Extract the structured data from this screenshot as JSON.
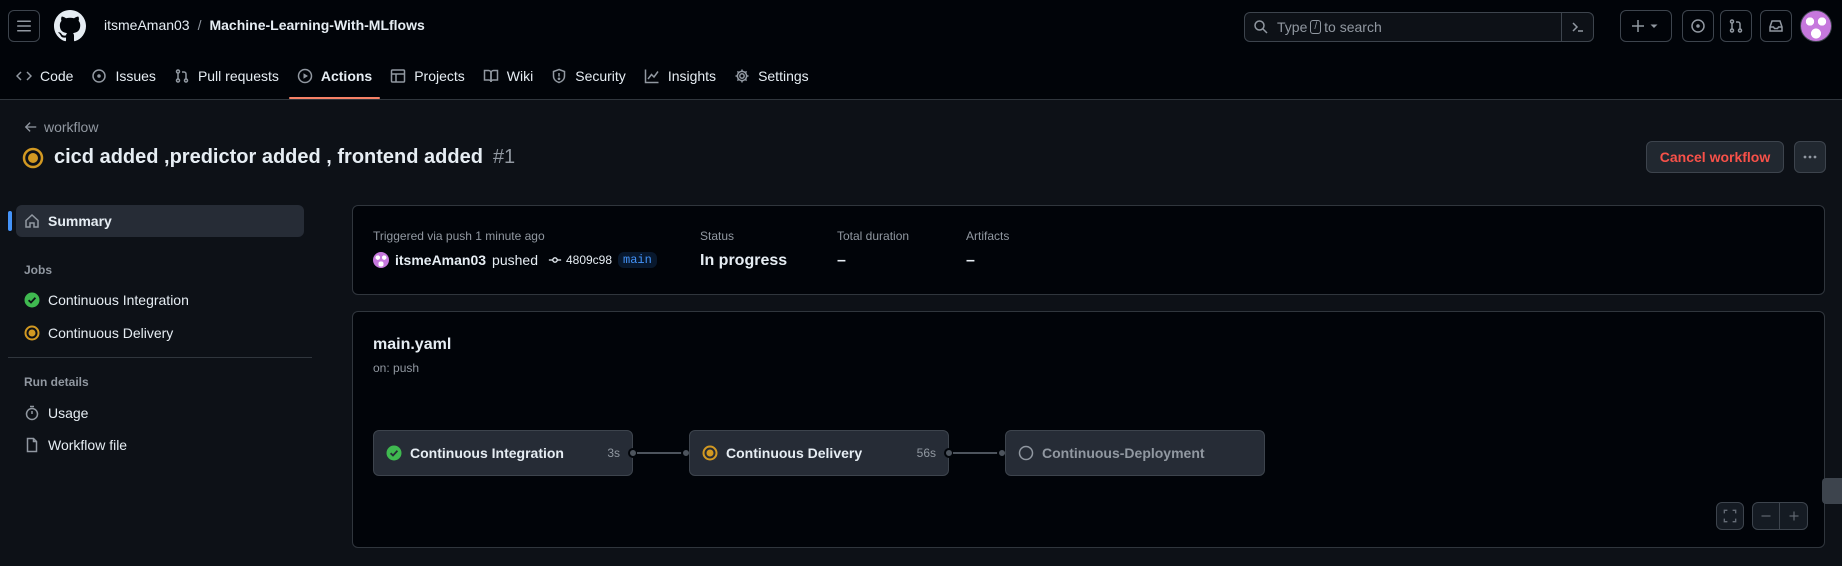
{
  "header": {
    "owner": "itsmeAman03",
    "separator": "/",
    "repo": "Machine-Learning-With-MLflows",
    "search": {
      "prefix": "Type",
      "key": "/",
      "suffix": "to search"
    }
  },
  "repo_nav": {
    "tabs": [
      {
        "label": "Code",
        "icon": "code-icon"
      },
      {
        "label": "Issues",
        "icon": "issue-icon"
      },
      {
        "label": "Pull requests",
        "icon": "pull-request-icon"
      },
      {
        "label": "Actions",
        "icon": "play-icon",
        "active": true
      },
      {
        "label": "Projects",
        "icon": "table-icon"
      },
      {
        "label": "Wiki",
        "icon": "book-icon"
      },
      {
        "label": "Security",
        "icon": "shield-icon"
      },
      {
        "label": "Insights",
        "icon": "graph-icon"
      },
      {
        "label": "Settings",
        "icon": "gear-icon"
      }
    ]
  },
  "run": {
    "back_label": "workflow",
    "title": "cicd added ,predictor added , frontend added",
    "number": "#1",
    "status_color": "#d29922",
    "cancel_label": "Cancel workflow"
  },
  "sidebar": {
    "summary_label": "Summary",
    "jobs_heading": "Jobs",
    "jobs": [
      {
        "label": "Continuous Integration",
        "status": "success"
      },
      {
        "label": "Continuous Delivery",
        "status": "in_progress"
      }
    ],
    "run_details_heading": "Run details",
    "details": [
      {
        "label": "Usage",
        "icon": "stopwatch-icon"
      },
      {
        "label": "Workflow file",
        "icon": "file-icon"
      }
    ]
  },
  "summary": {
    "trigger_label": "Triggered via push 1 minute ago",
    "actor": "itsmeAman03",
    "action": "pushed",
    "commit": "4809c98",
    "branch": "main",
    "status_label": "Status",
    "status_value": "In progress",
    "duration_label": "Total duration",
    "duration_value": "–",
    "artifacts_label": "Artifacts",
    "artifacts_value": "–"
  },
  "graph": {
    "file": "main.yaml",
    "trigger": "on: push",
    "jobs": [
      {
        "name": "Continuous Integration",
        "duration": "3s",
        "status": "success"
      },
      {
        "name": "Continuous Delivery",
        "duration": "56s",
        "status": "in_progress"
      },
      {
        "name": "Continuous-Deployment",
        "duration": "",
        "status": "pending"
      }
    ]
  },
  "colors": {
    "accent": "#4493f8",
    "success": "#3fb950",
    "in_progress": "#d29922",
    "danger": "#f85149",
    "tab_underline": "#f78166"
  }
}
